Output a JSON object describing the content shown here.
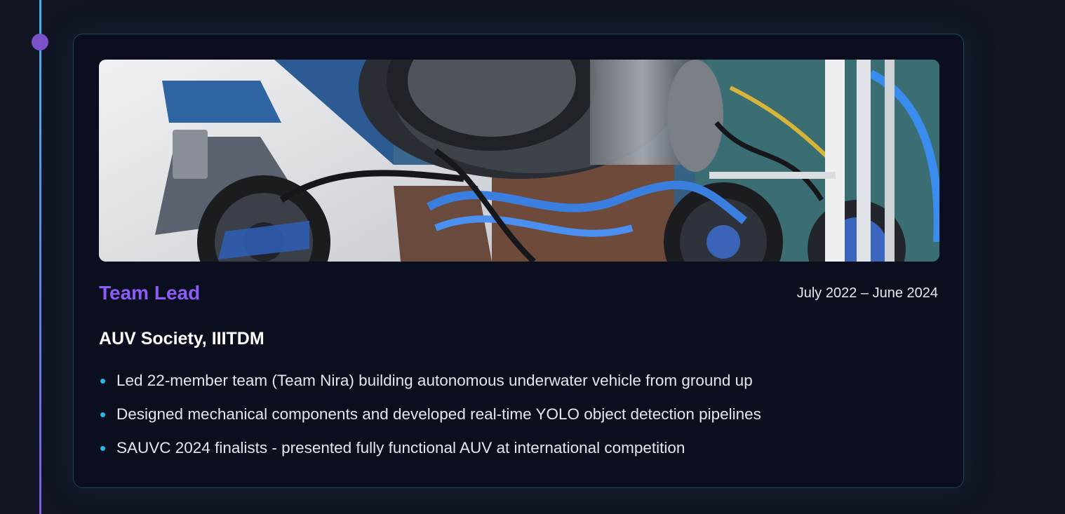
{
  "experience": {
    "role": "Team Lead",
    "dates": "July 2022 – June 2024",
    "organization": "AUV Society, IIITDM",
    "photo_icon": "auv-photo",
    "highlights": [
      "Led 22-member team (Team Nira) building autonomous underwater vehicle from ground up",
      "Designed mechanical components and developed real-time YOLO object detection pipelines",
      "SAUVC 2024 finalists - presented fully functional AUV at international competition"
    ]
  },
  "colors": {
    "role_accent": "#8b5cf6",
    "bullet_accent": "#22b8e8",
    "timeline_dot": "#7a52c9",
    "card_border": "#1b4658",
    "background": "#111524",
    "card_background": "#0b0e1f"
  }
}
